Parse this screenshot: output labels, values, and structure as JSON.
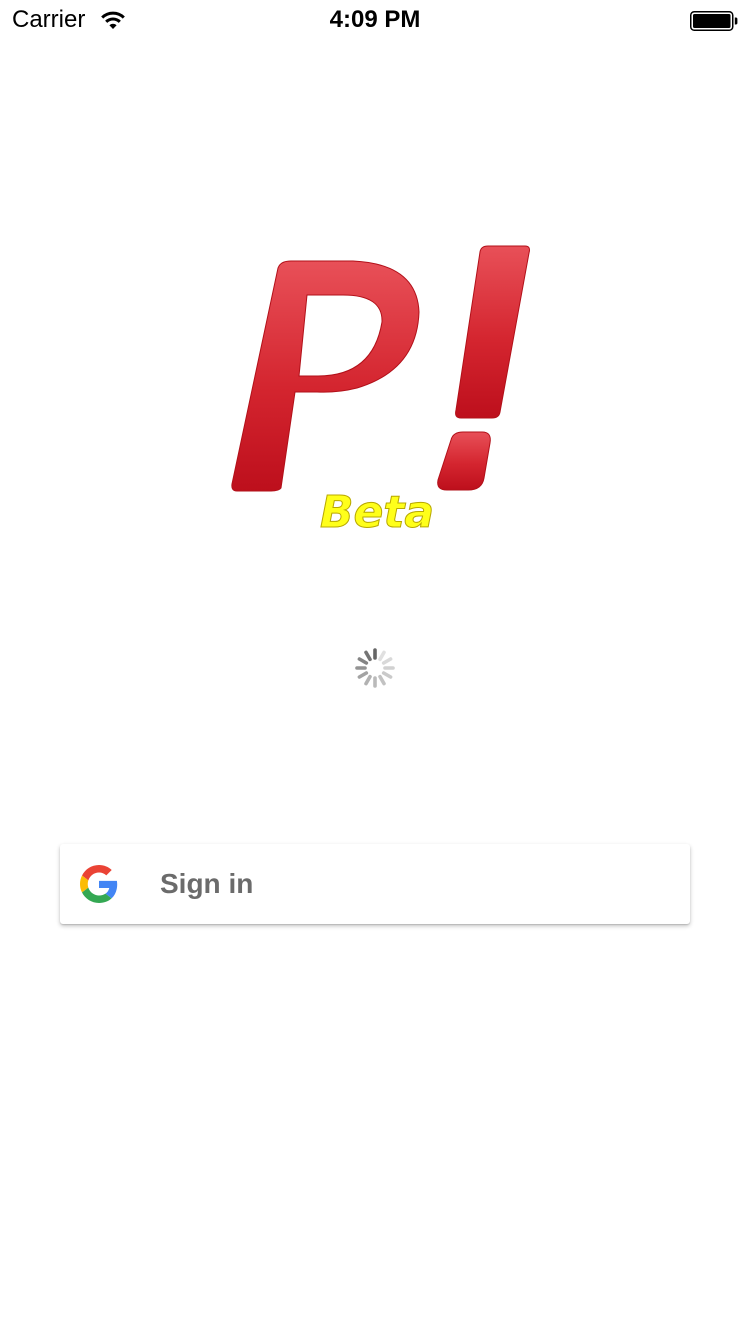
{
  "status_bar": {
    "carrier": "Carrier",
    "time": "4:09 PM",
    "wifi_icon": "wifi-icon",
    "battery_icon": "battery-icon"
  },
  "logo": {
    "text": "P!",
    "badge": "Beta",
    "primary_color": "#d8262f",
    "badge_color": "#ffff1a"
  },
  "loading": {
    "icon": "spinner-icon"
  },
  "signin_button": {
    "label": "Sign in",
    "icon": "google-g-icon"
  }
}
